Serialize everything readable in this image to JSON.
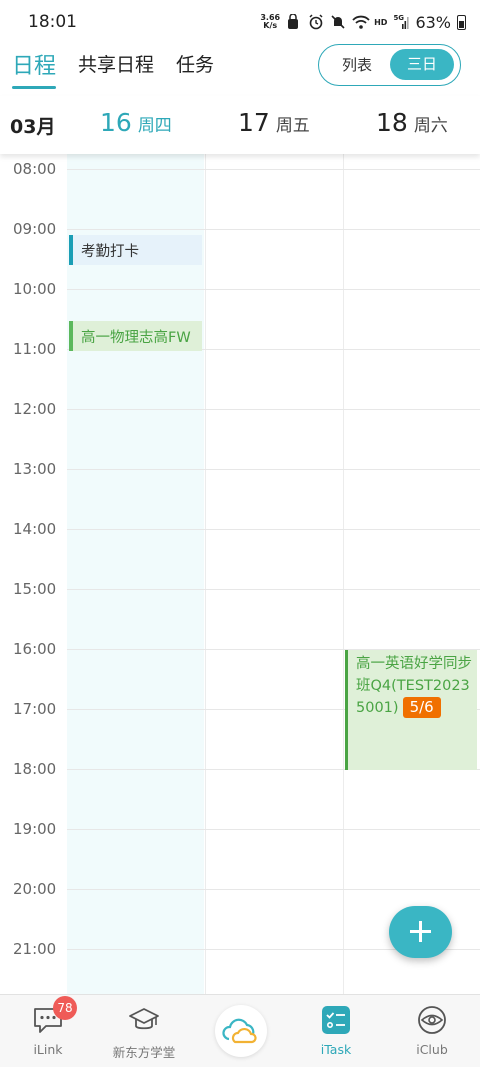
{
  "status_bar": {
    "time": "18:01",
    "net_speed_value": "3.66",
    "net_speed_unit": "K/s",
    "hd": "HD",
    "network": "5G",
    "battery": "63%"
  },
  "header": {
    "tabs": [
      "日程",
      "共享日程",
      "任务"
    ],
    "active_tab": "日程",
    "view_toggle": {
      "list": "列表",
      "three_day": "三日",
      "selected": "三日"
    }
  },
  "date_header": {
    "month": "03月",
    "days": [
      {
        "num": "16",
        "week": "周四",
        "today": true
      },
      {
        "num": "17",
        "week": "周五",
        "today": false
      },
      {
        "num": "18",
        "week": "周六",
        "today": false
      }
    ]
  },
  "hours": [
    "08:00",
    "09:00",
    "10:00",
    "11:00",
    "12:00",
    "13:00",
    "14:00",
    "15:00",
    "16:00",
    "17:00",
    "18:00",
    "19:00",
    "20:00",
    "21:00"
  ],
  "events": {
    "checkin": {
      "title": "考勤打卡",
      "color": "#1b9eb5"
    },
    "physics": {
      "title": "高一物理志高FW",
      "color": "#5cb85c"
    },
    "english": {
      "title": "高一英语好学同步班Q4(TEST20235001)",
      "badge": "5/6",
      "color": "#4aa444",
      "badge_color": "#f07000"
    }
  },
  "bottom_nav": {
    "items": [
      {
        "label": "iLink",
        "icon": "chat-icon",
        "badge": "78"
      },
      {
        "label": "新东方学堂",
        "icon": "graduation-cap-icon"
      },
      {
        "label": "",
        "icon": "cloud-logo-icon"
      },
      {
        "label": "iTask",
        "icon": "task-list-icon",
        "active": true
      },
      {
        "label": "iClub",
        "icon": "eye-icon"
      }
    ]
  },
  "colors": {
    "accent": "#2ea8b8"
  }
}
